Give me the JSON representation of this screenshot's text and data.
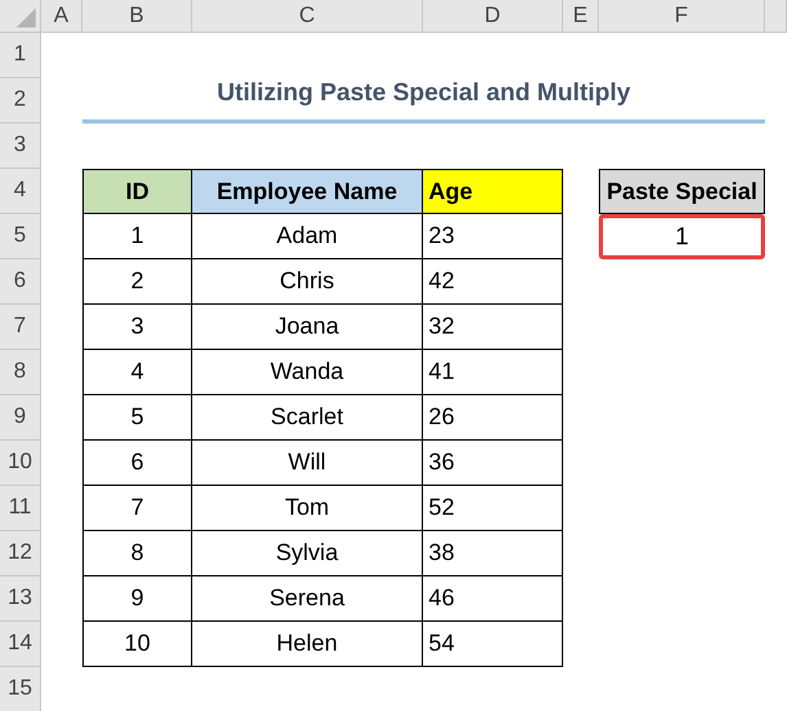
{
  "column_headers": [
    "A",
    "B",
    "C",
    "D",
    "E",
    "F"
  ],
  "row_headers": [
    "1",
    "2",
    "3",
    "4",
    "5",
    "6",
    "7",
    "8",
    "9",
    "10",
    "11",
    "12",
    "13",
    "14",
    "15"
  ],
  "title": "Utilizing Paste Special and Multiply",
  "table": {
    "columns": [
      {
        "label": "ID",
        "color": "#c6e0b4"
      },
      {
        "label": "Employee Name",
        "color": "#bdd7ee"
      },
      {
        "label": "Age",
        "color": "#ffff00"
      }
    ],
    "rows": [
      [
        "1",
        "Adam",
        "23"
      ],
      [
        "2",
        "Chris",
        "42"
      ],
      [
        "3",
        "Joana",
        "32"
      ],
      [
        "4",
        "Wanda",
        "41"
      ],
      [
        "5",
        "Scarlet",
        "26"
      ],
      [
        "6",
        "Will",
        "36"
      ],
      [
        "7",
        "Tom",
        "52"
      ],
      [
        "8",
        "Sylvia",
        "38"
      ],
      [
        "9",
        "Serena",
        "46"
      ],
      [
        "10",
        "Helen",
        "54"
      ]
    ]
  },
  "paste_special": {
    "header": "Paste Special",
    "value": "1",
    "highlighted": true
  }
}
